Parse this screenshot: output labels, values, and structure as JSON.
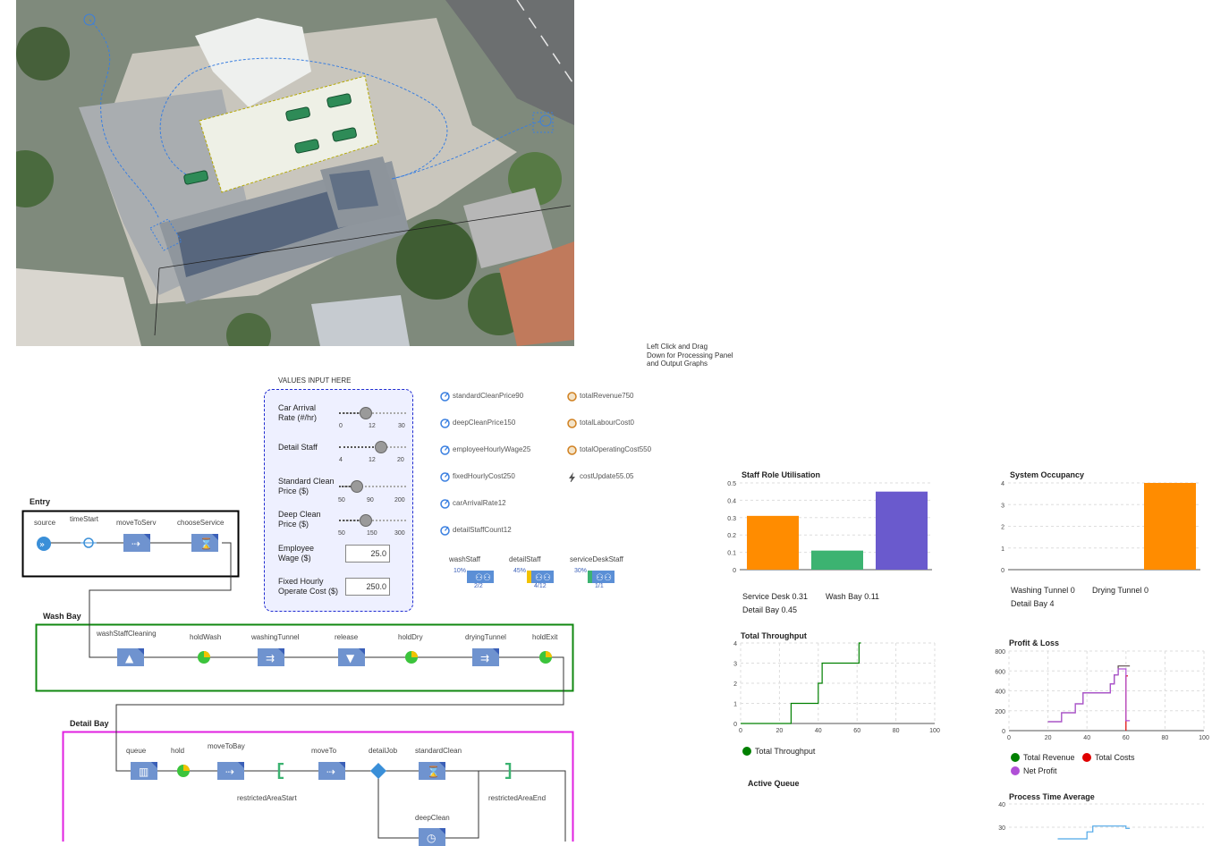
{
  "hint": [
    "Left Click and Drag",
    "Down for Processing Panel",
    "and Output Graphs"
  ],
  "inputs": {
    "title": "VALUES INPUT HERE",
    "car_arrival": {
      "label1": "Car Arrival",
      "label2": "Rate (#/hr)",
      "ticks": [
        "0",
        "12",
        "30"
      ],
      "value": 12,
      "min": 0,
      "max": 30
    },
    "detail_staff": {
      "label1": "Detail Staff",
      "label2": "",
      "ticks": [
        "4",
        "12",
        "20"
      ],
      "value": 14,
      "min": 4,
      "max": 20
    },
    "standard_clean": {
      "label1": "Standard Clean",
      "label2": "Price ($)",
      "ticks": [
        "50",
        "90",
        "200"
      ],
      "value": 90,
      "min": 50,
      "max": 200
    },
    "deep_clean": {
      "label1": "Deep Clean",
      "label2": "Price ($)",
      "ticks": [
        "50",
        "150",
        "300"
      ],
      "value": 150,
      "min": 50,
      "max": 300
    },
    "employee_wage": {
      "label1": "Employee",
      "label2": "Wage ($)",
      "value": "25.0"
    },
    "fixed_cost": {
      "label1": "Fixed Hourly",
      "label2": "Operate Cost ($)",
      "value": "250.0"
    }
  },
  "params": [
    {
      "name": "standardCleanPrice",
      "value": "90"
    },
    {
      "name": "deepCleanPrice",
      "value": "150"
    },
    {
      "name": "employeeHourlyWage",
      "value": "25"
    },
    {
      "name": "fixedHourlyCost",
      "value": "250"
    },
    {
      "name": "carArrivalRate",
      "value": "12"
    },
    {
      "name": "detailStaffCount",
      "value": "12"
    }
  ],
  "outputs": [
    {
      "name": "totalRevenue",
      "value": "750"
    },
    {
      "name": "totalLabourCost",
      "value": "0"
    },
    {
      "name": "totalOperatingCost",
      "value": "550"
    },
    {
      "name": "costUpdate",
      "value": "55.05"
    }
  ],
  "resources": [
    {
      "name": "washStaff",
      "pct": "10%",
      "count": "2/2"
    },
    {
      "name": "detailStaff",
      "pct": "45%",
      "count": "4/12"
    },
    {
      "name": "serviceDeskStaff",
      "pct": "30%",
      "count": "1/1"
    }
  ],
  "sections": {
    "entry": "Entry",
    "wash": "Wash Bay",
    "detail": "Detail Bay"
  },
  "entry_blocks": {
    "source": "source",
    "timeStart": "timeStart",
    "moveToServ": "moveToServ",
    "chooseService": "chooseService"
  },
  "wash_blocks": {
    "washStaffCleaning": "washStaffCleaning",
    "holdWash": "holdWash",
    "washingTunnel": "washingTunnel",
    "release": "release",
    "holdDry": "holdDry",
    "dryingTunnel": "dryingTunnel",
    "holdExit": "holdExit"
  },
  "detail_blocks": {
    "queue": "queue",
    "hold": "hold",
    "moveToBay": "moveToBay",
    "moveTo": "moveTo",
    "detailJob": "detailJob",
    "standardClean": "standardClean",
    "restrictedAreaStart": "restrictedAreaStart",
    "restrictedAreaEnd": "restrictedAreaEnd",
    "deepClean": "deepClean"
  },
  "colors": {
    "orange": "#ff8c00",
    "green": "#3cb371",
    "purple": "#6a5acd",
    "darkgreen": "#008000",
    "red": "#e00000",
    "violet": "#b04fd6",
    "lightpurple": "#8b7cf6",
    "pink": "#f02090",
    "blue": "#4da6e8"
  },
  "charts": {
    "staff_util": {
      "title": "Staff Role Utilisation",
      "chart_data": {
        "type": "bar",
        "categories": [
          "Service Desk",
          "Wash Bay",
          "Detail Bay"
        ],
        "values": [
          0.31,
          0.11,
          0.45
        ],
        "ylim": [
          0,
          0.5
        ],
        "yticks": [
          "0",
          "0.1",
          "0.2",
          "0.3",
          "0.4",
          "0.5"
        ]
      },
      "legend": [
        {
          "name": "Service Desk",
          "value": "0.31"
        },
        {
          "name": "Wash Bay",
          "value": "0.11"
        },
        {
          "name": "Detail Bay",
          "value": "0.45"
        }
      ]
    },
    "occupancy": {
      "title": "System Occupancy",
      "chart_data": {
        "type": "bar",
        "categories": [
          "Washing Tunnel",
          "Drying Tunnel",
          "Detail Bay"
        ],
        "values": [
          0,
          0,
          4
        ],
        "ylim": [
          0,
          4
        ],
        "yticks": [
          "0",
          "1",
          "2",
          "3",
          "4"
        ]
      },
      "legend": [
        {
          "name": "Washing Tunnel",
          "value": "0"
        },
        {
          "name": "Drying Tunnel",
          "value": "0"
        },
        {
          "name": "Detail Bay",
          "value": "4"
        }
      ]
    },
    "throughput": {
      "title": "Total Throughput",
      "chart_data": {
        "type": "line",
        "xlim": [
          0,
          100
        ],
        "ylim": [
          0,
          4
        ],
        "xticks": [
          "0",
          "20",
          "40",
          "60",
          "80",
          "100"
        ],
        "yticks": [
          "0",
          "1",
          "2",
          "3",
          "4"
        ],
        "series": [
          {
            "name": "Total Throughput",
            "points": [
              [
                0,
                0
              ],
              [
                26,
                0
              ],
              [
                26,
                1
              ],
              [
                40,
                1
              ],
              [
                40,
                2
              ],
              [
                42,
                2
              ],
              [
                42,
                3
              ],
              [
                45,
                3
              ],
              [
                45,
                3
              ],
              [
                61,
                3
              ],
              [
                61,
                4
              ],
              [
                62,
                4
              ]
            ]
          }
        ]
      }
    },
    "profit": {
      "title": "Profit & Loss",
      "chart_data": {
        "type": "line",
        "xlim": [
          0,
          100
        ],
        "ylim": [
          0,
          800
        ],
        "xticks": [
          "0",
          "20",
          "40",
          "60",
          "80",
          "100"
        ],
        "yticks": [
          "0",
          "200",
          "400",
          "600",
          "800"
        ],
        "series": [
          {
            "name": "Total Revenue",
            "points": [
              [
                20,
                90
              ],
              [
                27,
                90
              ],
              [
                27,
                180
              ],
              [
                34,
                180
              ],
              [
                34,
                270
              ],
              [
                38,
                270
              ],
              [
                38,
                380
              ],
              [
                52,
                380
              ],
              [
                52,
                470
              ],
              [
                54,
                470
              ],
              [
                54,
                560
              ],
              [
                56,
                560
              ],
              [
                56,
                650
              ],
              [
                62,
                650
              ]
            ]
          },
          {
            "name": "Total Costs",
            "points": [
              [
                60,
                0
              ],
              [
                60,
                550
              ],
              [
                61,
                550
              ]
            ]
          },
          {
            "name": "Net Profit",
            "points": [
              [
                20,
                90
              ],
              [
                27,
                90
              ],
              [
                27,
                180
              ],
              [
                34,
                180
              ],
              [
                34,
                270
              ],
              [
                38,
                270
              ],
              [
                38,
                380
              ],
              [
                52,
                380
              ],
              [
                52,
                470
              ],
              [
                54,
                470
              ],
              [
                54,
                560
              ],
              [
                56,
                560
              ],
              [
                56,
                620
              ],
              [
                60,
                620
              ],
              [
                60,
                100
              ],
              [
                62,
                100
              ]
            ]
          }
        ]
      }
    },
    "active_queue": {
      "title": "Active Queue"
    },
    "process_time": {
      "title": "Process Time Average",
      "chart_data": {
        "type": "line",
        "ylim": [
          20,
          40
        ],
        "yticks": [
          "30",
          "40"
        ],
        "series": [
          {
            "name": "",
            "points": [
              [
                25,
                25
              ],
              [
                40,
                25
              ],
              [
                40,
                28
              ],
              [
                43,
                28
              ],
              [
                43,
                30.5
              ],
              [
                60,
                30.5
              ],
              [
                60,
                29.5
              ],
              [
                62,
                29.5
              ]
            ]
          }
        ]
      }
    }
  }
}
